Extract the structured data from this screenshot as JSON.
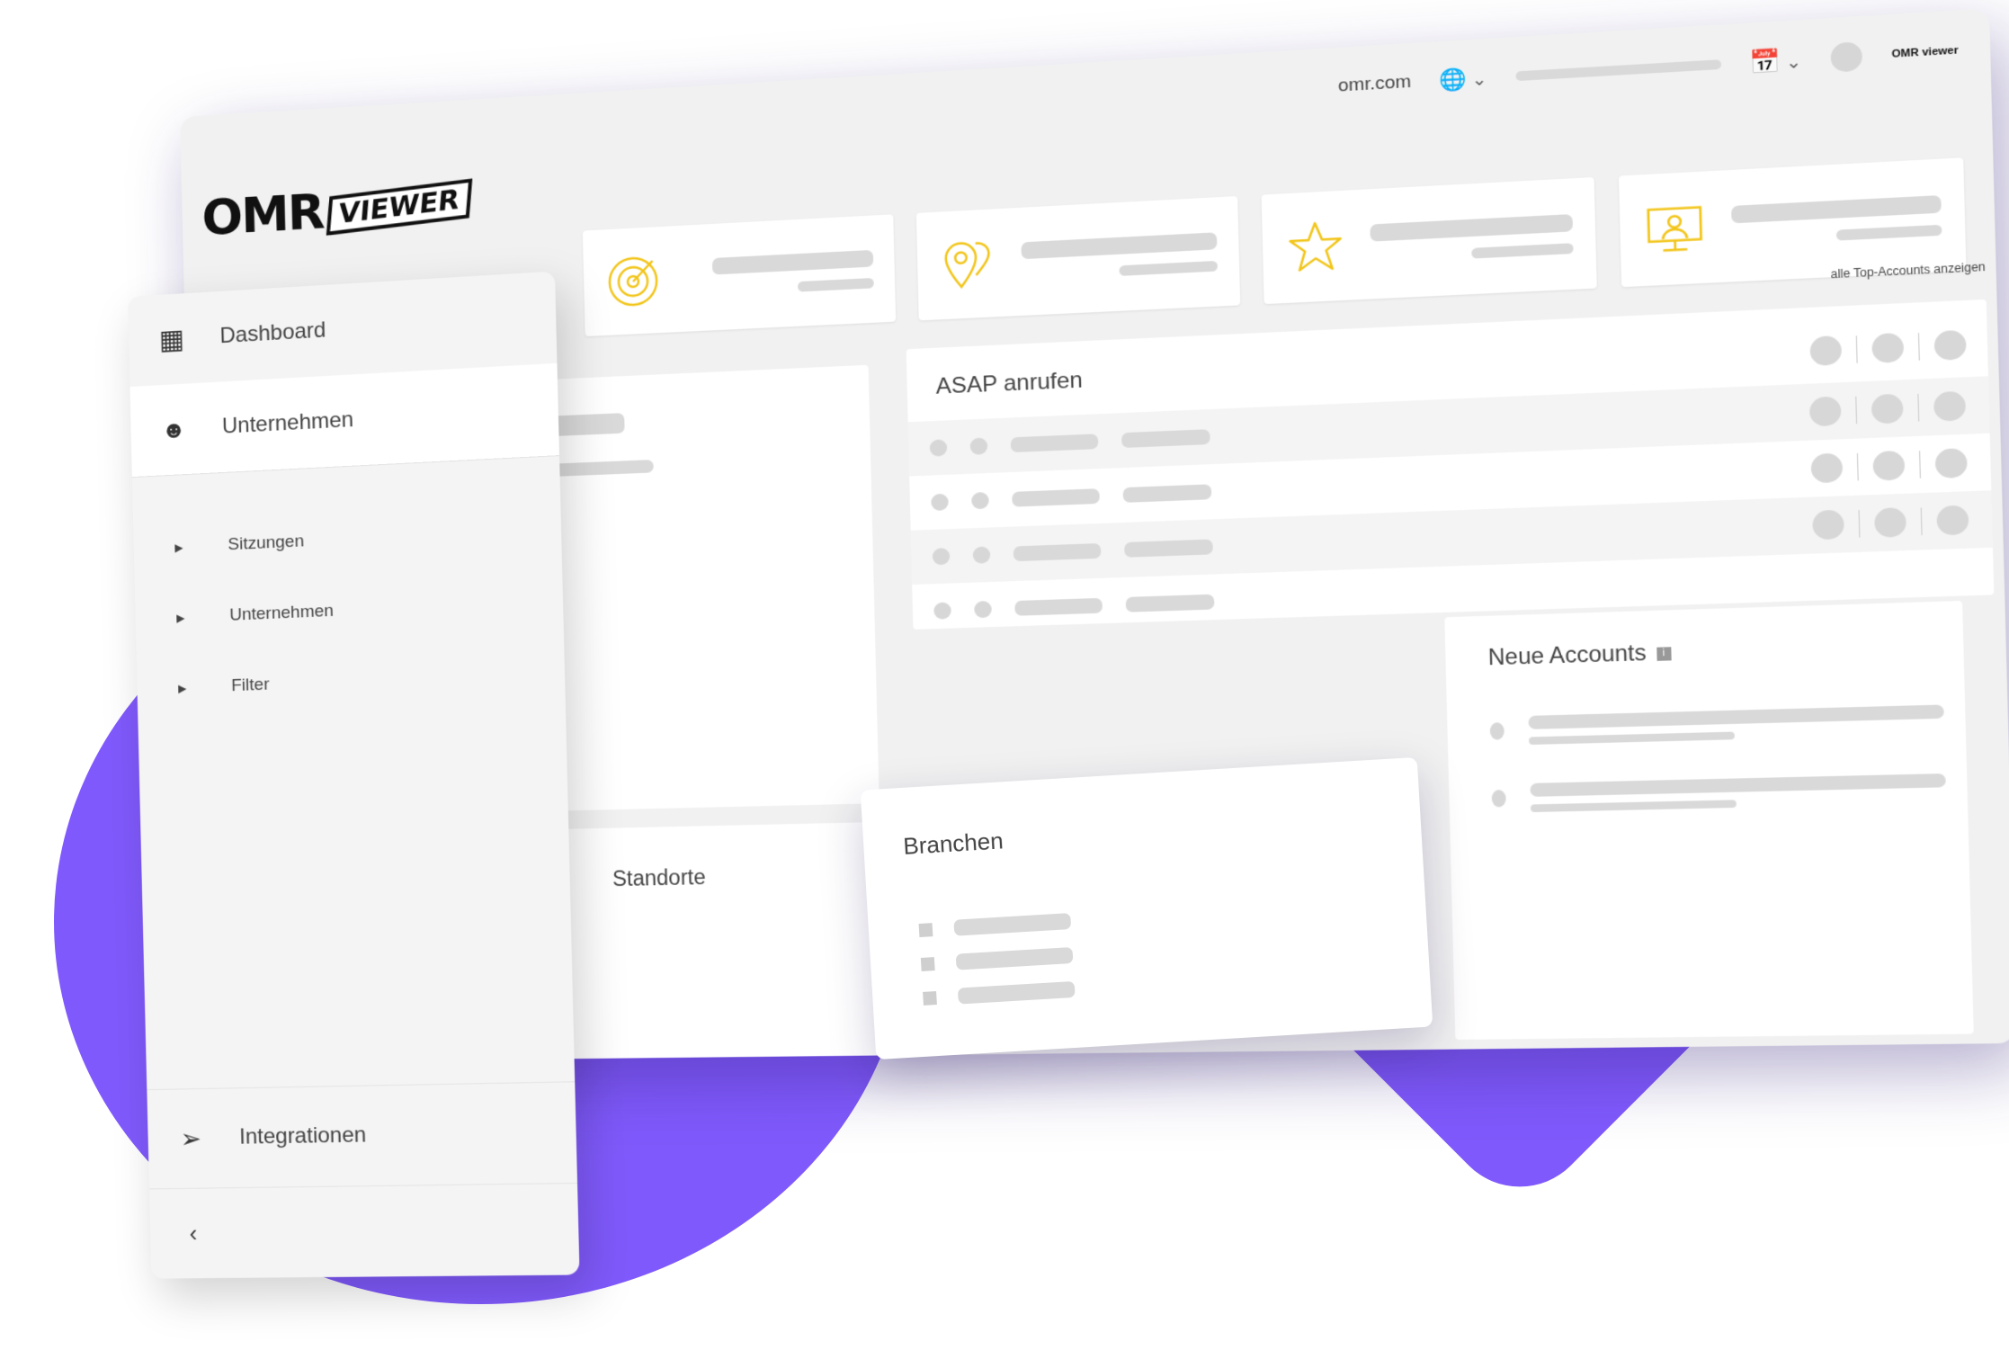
{
  "brand": {
    "logo_text": "OMR",
    "logo_badge": "VIEWER",
    "mini_logo": "OMR viewer"
  },
  "topbar": {
    "domain": "omr.com"
  },
  "sidebar": {
    "items": [
      {
        "label": "Dashboard",
        "icon": "dashboard-icon"
      },
      {
        "label": "Unternehmen",
        "icon": "person-icon"
      }
    ],
    "subitems": [
      {
        "label": "Sitzungen"
      },
      {
        "label": "Unternehmen"
      },
      {
        "label": "Filter"
      }
    ],
    "bottom": {
      "label": "Integrationen",
      "icon": "integrations-icon"
    },
    "collapse_icon": "chevron-left-icon"
  },
  "stats": [
    {
      "icon": "radar-icon"
    },
    {
      "icon": "map-pin-icon"
    },
    {
      "icon": "star-icon"
    },
    {
      "icon": "monitor-user-icon"
    }
  ],
  "asap": {
    "link": "alle Top-Accounts anzeigen",
    "title": "ASAP anrufen"
  },
  "neue_accounts": {
    "title": "Neue Accounts",
    "info": "i"
  },
  "standorte": {
    "title": "Standorte"
  },
  "branchen": {
    "title": "Branchen"
  },
  "colors": {
    "accent": "#8059fc",
    "icon_yellow": "#f2c51a"
  }
}
